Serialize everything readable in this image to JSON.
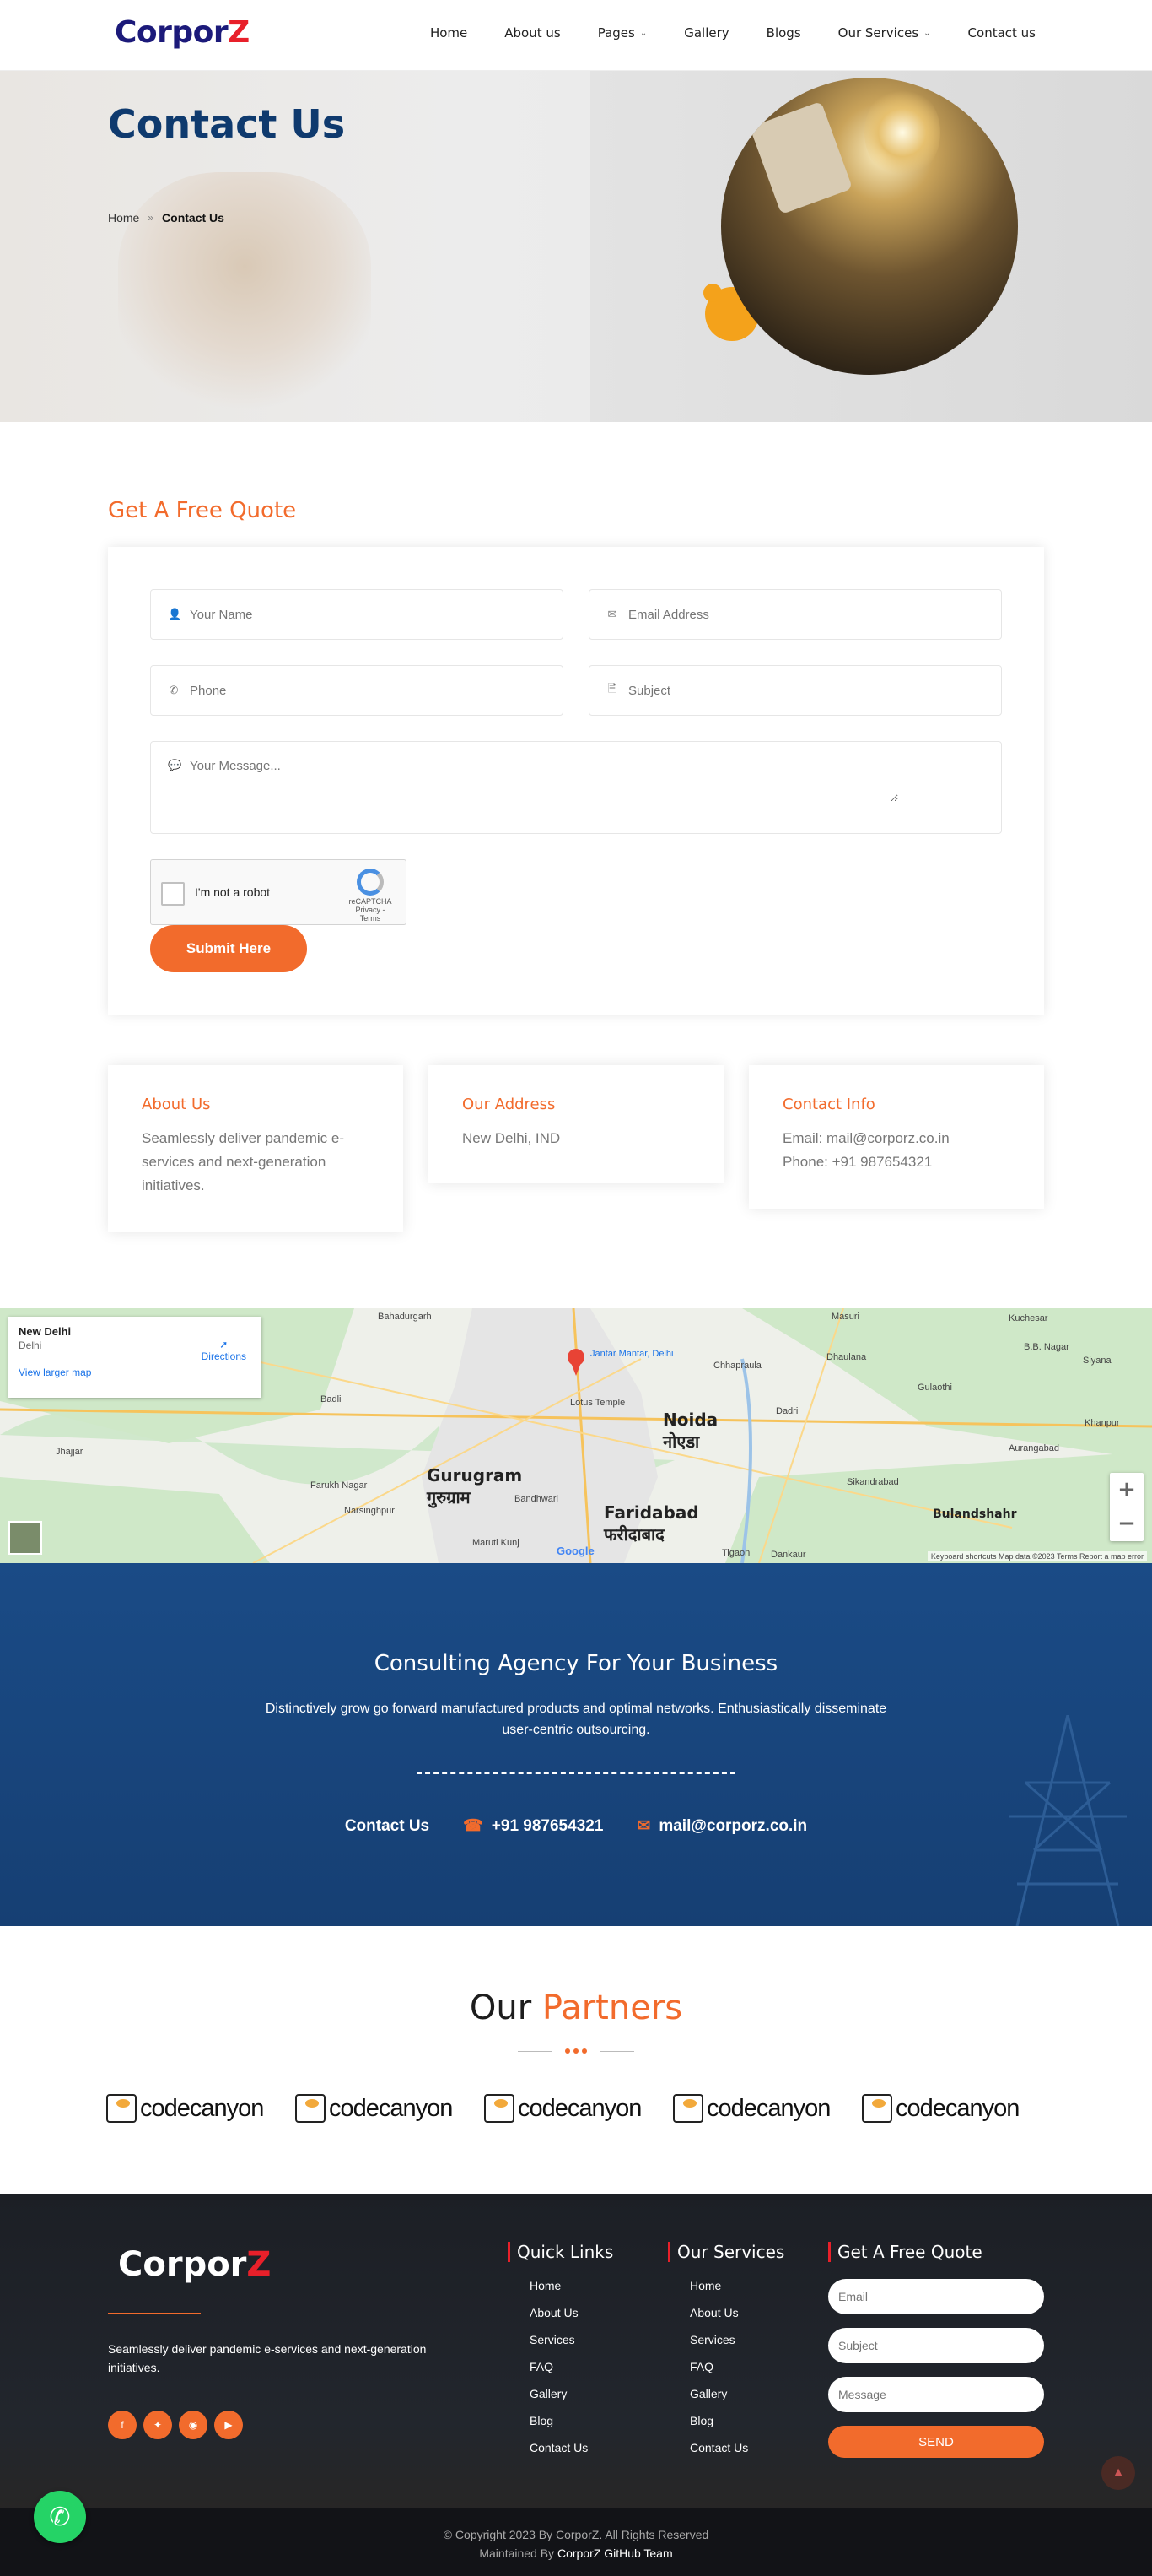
{
  "header": {
    "logo_main": "Corpor",
    "logo_accent": "Z",
    "menu": [
      {
        "label": "Home"
      },
      {
        "label": "About us"
      },
      {
        "label": "Pages"
      },
      {
        "label": "Gallery"
      },
      {
        "label": "Blogs"
      },
      {
        "label": "Our Services"
      },
      {
        "label": "Contact us"
      }
    ]
  },
  "hero": {
    "title": "Contact Us",
    "breadcrumb": {
      "home": "Home",
      "separator": "»",
      "current": "Contact Us"
    }
  },
  "quote": {
    "title": "Get A Free Quote",
    "name_placeholder": "Your Name",
    "email_placeholder": "Email Address",
    "phone_placeholder": "Phone",
    "subject_placeholder": "Subject",
    "message_placeholder": "Your Message...",
    "captcha_label": "I'm not a robot",
    "captcha_brand": "reCAPTCHA",
    "captcha_links": "Privacy - Terms",
    "submit_label": "Submit Here"
  },
  "info": {
    "about": {
      "title": "About Us",
      "text": "Seamlessly deliver pandemic e-services and next-generation initiatives."
    },
    "address": {
      "title": "Our Address",
      "text": "New Delhi, IND"
    },
    "contact": {
      "title": "Contact Info",
      "email": "Email: mail@corporz.co.in",
      "phone": "Phone: +91 987654321"
    }
  },
  "map": {
    "place_title": "New Delhi",
    "place_sub": "Delhi",
    "directions": "Directions",
    "larger_map": "View larger map",
    "pin_label": "Jantar Mantar, Delhi",
    "labels": {
      "noida": "Noida",
      "noida_hi": "नोएडा",
      "gurugram": "Gurugram",
      "gurugram_hi": "गुरुग्राम",
      "faridabad": "Faridabad",
      "faridabad_hi": "फरीदाबाद",
      "lotus": "Lotus Temple",
      "bahadurgarh": "Bahadurgarh",
      "badli": "Badli",
      "jhajjar": "Jhajjar",
      "farukh": "Farukh Nagar",
      "bulandshahr": "Bulandshahr",
      "dadri": "Dadri",
      "dhaulana": "Dhaulana",
      "sikandrabad": "Sikandrabad",
      "tigaon": "Tigaon",
      "dankaur": "Dankaur",
      "kuchesar": "Kuchesar",
      "bbnagar": "B.B. Nagar",
      "khanpur": "Khanpur",
      "masuri": "Masuri",
      "chhaprauIa": "Chhapraula",
      "gulaothi": "Gulaothi",
      "aurangabad": "Aurangabad",
      "siyana": "Siyana",
      "marutikunj": "Maruti Kunj",
      "bandhwari": "Bandhwari",
      "narsinghpur": "Narsinghpur"
    },
    "footer": "Keyboard shortcuts   Map data ©2023   Terms   Report a map error",
    "google": "Google"
  },
  "consult": {
    "title": "Consulting Agency For Your Business",
    "text": "Distinctively grow go forward manufactured products and optimal networks. Enthusiastically disseminate user-centric outsourcing.",
    "contact_label": "Contact Us",
    "phone": "+91 987654321",
    "email": "mail@corporz.co.in"
  },
  "partners": {
    "title_a": "Our",
    "title_b": "Partners",
    "logos": [
      "codecanyon",
      "codecanyon",
      "codecanyon",
      "codecanyon",
      "codecanyon"
    ]
  },
  "footer": {
    "logo_main": "Corpor",
    "logo_accent": "Z",
    "desc": "Seamlessly deliver pandemic e-services and next-generation initiatives.",
    "quick_title": "Quick Links",
    "quick": [
      "Home",
      "About Us",
      "Services",
      "FAQ",
      "Gallery",
      "Blog",
      "Contact Us"
    ],
    "services_title": "Our Services",
    "services": [
      "Home",
      "About Us",
      "Services",
      "FAQ",
      "Gallery",
      "Blog",
      "Contact Us"
    ],
    "quote_title": "Get A Free Quote",
    "email_ph": "Email",
    "subject_ph": "Subject",
    "message_ph": "Message",
    "send": "SEND",
    "copyright": "© Copyright 2023 By CorporZ. All Rights Reserved",
    "maintained_prefix": "Maintained By",
    "maintained_by": "CorporZ GitHub Team"
  },
  "colors": {
    "accent": "#f26b2c",
    "navy": "#0f3a6e",
    "logo": "#1c1a7a",
    "logo_z": "#e8202a",
    "whatsapp": "#25d366"
  },
  "icons": {
    "user": "user-icon",
    "mail": "mail-icon",
    "phone": "phone-icon",
    "file": "file-icon",
    "comment": "comment-icon",
    "headset": "headset-icon",
    "envelope": "envelope-icon"
  }
}
